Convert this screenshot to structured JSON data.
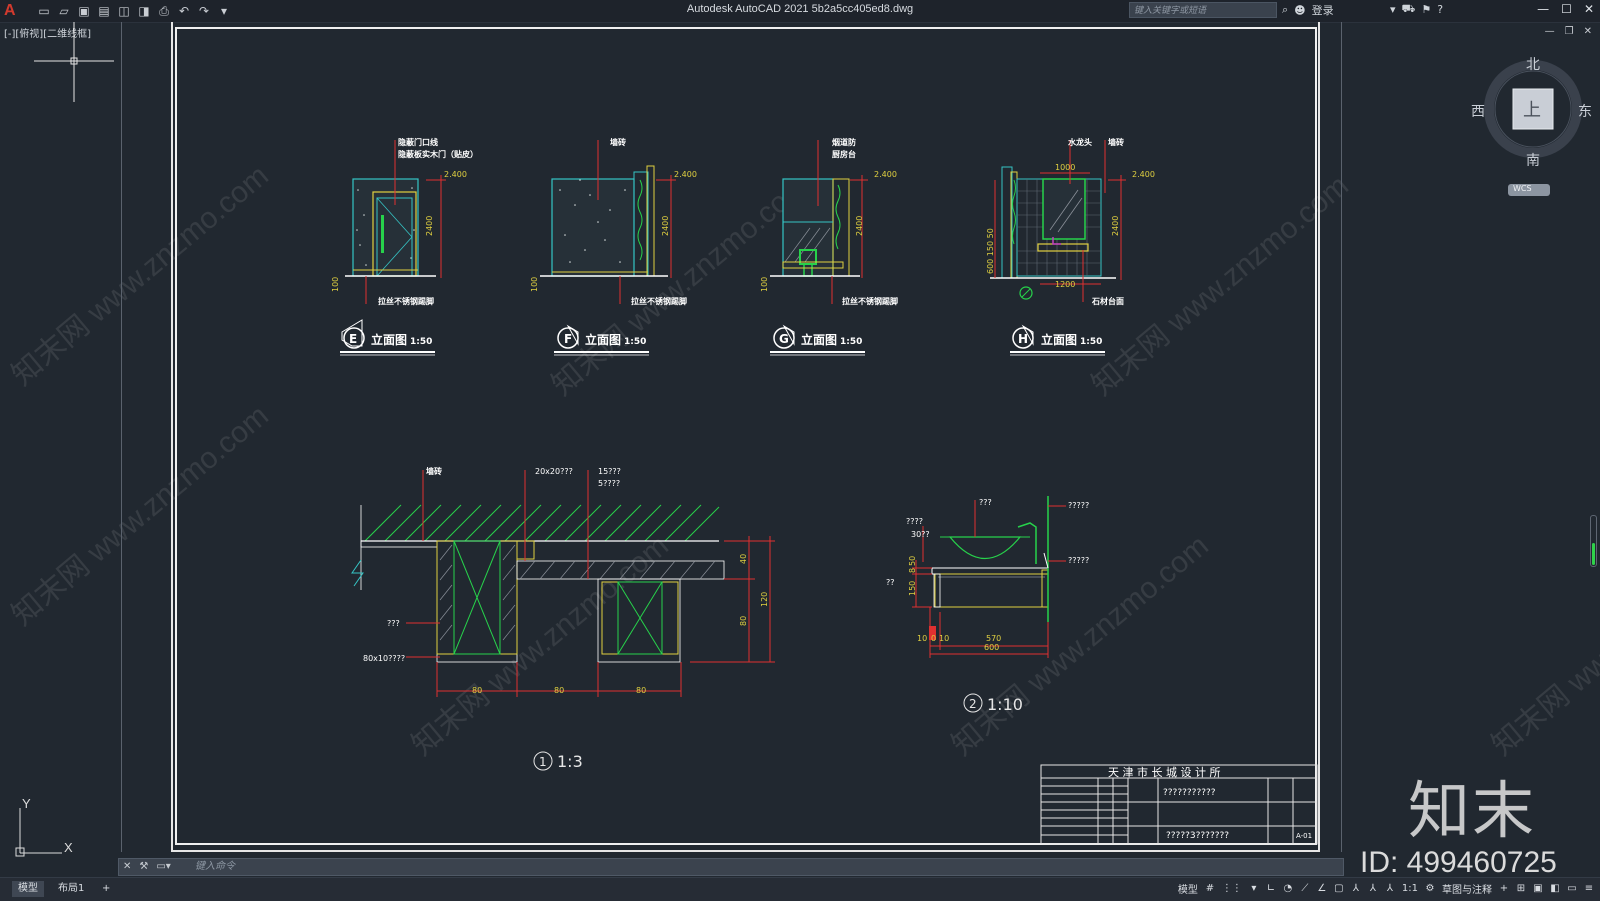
{
  "app": {
    "logo": "A",
    "title": "Autodesk AutoCAD 2021    5b2a5cc405ed8.dwg",
    "search_placeholder": "键入关键字或短语",
    "login": "登录",
    "view_label": "[-][俯视][二维线框]"
  },
  "viewcube": {
    "north": "北",
    "south": "南",
    "east": "东",
    "west": "西",
    "face": "上",
    "wcs": "WCS"
  },
  "ucs": {
    "y": "Y",
    "x": "X"
  },
  "drawing": {
    "elevations": [
      {
        "letter": "E",
        "title": "立面图",
        "scale": "1:50",
        "label_top_1": "隐蔽门口线",
        "label_top_2": "隐蔽板实木门（贴皮）",
        "label_bottom": "拉丝不锈钢踢脚",
        "dim_top": "2.400",
        "dim_side": "2400",
        "dim_base": "100"
      },
      {
        "letter": "F",
        "title": "立面图",
        "scale": "1:50",
        "label_top_1": "墙砖",
        "label_bottom": "拉丝不锈钢踢脚",
        "dim_top": "2.400",
        "dim_side": "2400",
        "dim_base": "100"
      },
      {
        "letter": "G",
        "title": "立面图",
        "scale": "1:50",
        "label_top_1": "烟道防",
        "label_top_2": "厨房台",
        "label_bottom": "拉丝不锈钢踢脚",
        "dim_top": "2.400",
        "dim_side": "2400",
        "dim_base": "100"
      },
      {
        "letter": "H",
        "title": "立面图",
        "scale": "1:50",
        "label_top_1": "水龙头",
        "label_top_2": "墙砖",
        "label_bottom": "石材台面",
        "dim_top": "2.400",
        "dim_side": "2400",
        "dim_width_top": "1000",
        "dim_width_bottom": "1200",
        "dim_left": "600 150 50"
      }
    ],
    "detail1": {
      "label_1": "墙砖",
      "label_2": "20x20???",
      "label_3": "15???",
      "label_4": "5????",
      "label_left_1": "???",
      "label_left_2": "80x10????",
      "dims_bottom": [
        "80",
        "80",
        "80"
      ],
      "dims_right": [
        "40",
        "80",
        "120"
      ],
      "number": "1",
      "scale": "1:3"
    },
    "detail2": {
      "label_1": "???",
      "label_2": "?????",
      "label_3": "?????",
      "label_4": "????",
      "label_5": "30??",
      "label_6": "??",
      "dims_left": [
        "50",
        "8",
        "150"
      ],
      "dims_bottom": [
        "10",
        "0",
        "10",
        "570",
        "600"
      ],
      "number": "2",
      "scale": "1:10"
    },
    "title_block": {
      "company": "天 津 市 长 城 设 计 所",
      "project": "???????????",
      "drawing_name": "?????3???????",
      "drawing_no": "A-01"
    }
  },
  "command_line": {
    "placeholder": "键入命令"
  },
  "status": {
    "tab_model": "模型",
    "tab_layout": "布局1",
    "tab_add": "+",
    "model_label": "模型",
    "scale": "1:1",
    "annotation": "草图与注释"
  },
  "watermark": {
    "brand": "知末",
    "id": "ID: 499460725",
    "site": "知末网 www.znzmo.com"
  }
}
